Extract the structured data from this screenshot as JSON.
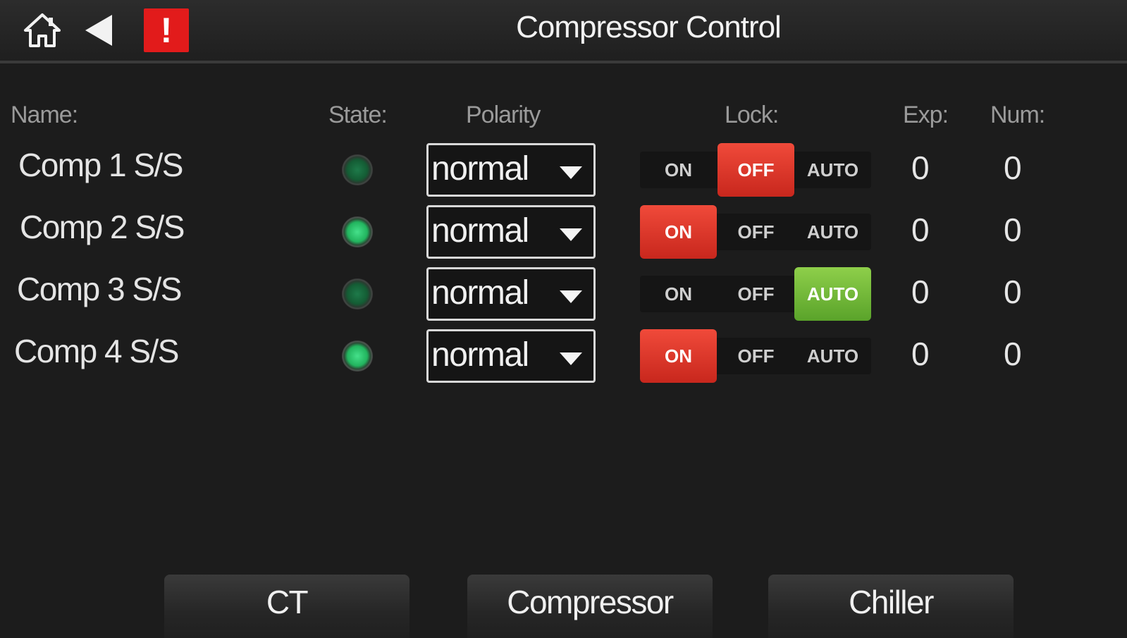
{
  "header": {
    "title": "Compressor Control",
    "icons": [
      "home-icon",
      "back-icon",
      "alarm-icon"
    ],
    "alarm_glyph": "!",
    "alarm_color": "#e21b1b"
  },
  "columns": {
    "name": "Name:",
    "state": "State:",
    "polarity": "Polarity",
    "lock": "Lock:",
    "exp": "Exp:",
    "num": "Num:"
  },
  "lock_options": [
    "ON",
    "OFF",
    "AUTO"
  ],
  "rows": [
    {
      "name": "Comp 1 S/S",
      "state": "off",
      "polarity": "normal",
      "lock": "OFF",
      "exp": "0",
      "num": "0",
      "lock_labels": {
        "on": "ON",
        "off": "OFF",
        "auto": "AUTO"
      }
    },
    {
      "name": "Comp 2 S/S",
      "state": "on",
      "polarity": "normal",
      "lock": "ON",
      "exp": "0",
      "num": "0",
      "lock_labels": {
        "on": "ON",
        "off": "OFF",
        "auto": "AUTO"
      }
    },
    {
      "name": "Comp 3 S/S",
      "state": "off",
      "polarity": "normal",
      "lock": "AUTO",
      "exp": "0",
      "num": "0",
      "lock_labels": {
        "on": "ON",
        "off": "OFF",
        "auto": "AUTO"
      }
    },
    {
      "name": "Comp 4 S/S",
      "state": "on",
      "polarity": "normal",
      "lock": "ON",
      "exp": "0",
      "num": "0",
      "lock_labels": {
        "on": "ON",
        "off": "OFF",
        "auto": "AUTO"
      }
    }
  ],
  "nav": {
    "ct": "CT",
    "compressor": "Compressor",
    "chiller": "Chiller"
  },
  "colors": {
    "lock_active_on_off": "#e03a2c",
    "lock_active_auto": "#74bb3a",
    "led_on": "#33cc72",
    "led_off": "#1a6a40"
  }
}
